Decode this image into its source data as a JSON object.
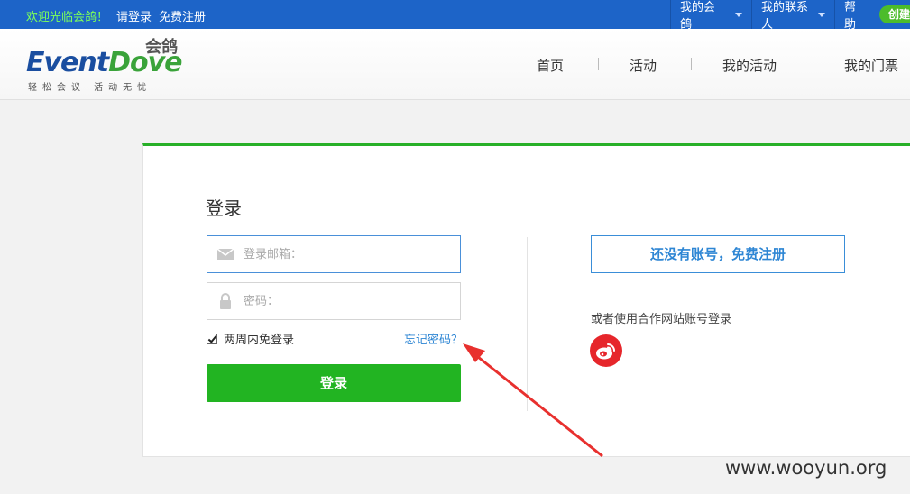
{
  "topbar": {
    "welcome": "欢迎光临会鸽！",
    "login": "请登录",
    "register": "免费注册",
    "menus": [
      "我的会鸽",
      "我的联系人",
      "帮助"
    ],
    "create": "创建"
  },
  "brand": {
    "logo_event": "Event",
    "logo_dove": "Dove",
    "logo_cn": "会鸽",
    "slogan": "轻松会议  活动无忧"
  },
  "nav": [
    "首页",
    "活动",
    "我的活动",
    "我的门票"
  ],
  "login": {
    "title": "登录",
    "email_placeholder": "登录邮箱：",
    "password_placeholder": "密码：",
    "remember_label": "两周内免登录",
    "forgot_label": "忘记密码？",
    "submit_label": "登录"
  },
  "side": {
    "signup_label": "还没有账号，免费注册",
    "partner_text": "或者使用合作网站账号登录"
  },
  "watermark": "www.wooyun.org",
  "colors": {
    "topbar": "#1d64c8",
    "accent_green": "#22b422",
    "link_blue": "#2e86d4",
    "weibo_red": "#e6262b",
    "arrow_red": "#e8302e"
  }
}
